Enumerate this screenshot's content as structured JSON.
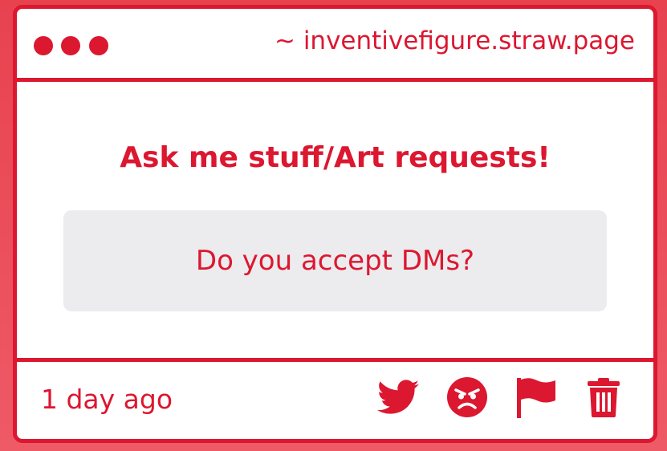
{
  "window": {
    "url": "~ inventivefigure.straw.page",
    "controls": [
      "dot",
      "dot",
      "dot"
    ]
  },
  "question": {
    "title": "Ask me stuff/Art requests!",
    "text": "Do you accept DMs?"
  },
  "footer": {
    "timestamp": "1 day ago",
    "actions": [
      {
        "icon": "twitter-bird-icon"
      },
      {
        "icon": "angry-face-icon"
      },
      {
        "icon": "flag-icon"
      },
      {
        "icon": "trash-icon"
      }
    ]
  },
  "colors": {
    "accent": "#dc1730",
    "background": "#e8424f",
    "card": "#ffffff",
    "question_box": "#ecebed"
  }
}
